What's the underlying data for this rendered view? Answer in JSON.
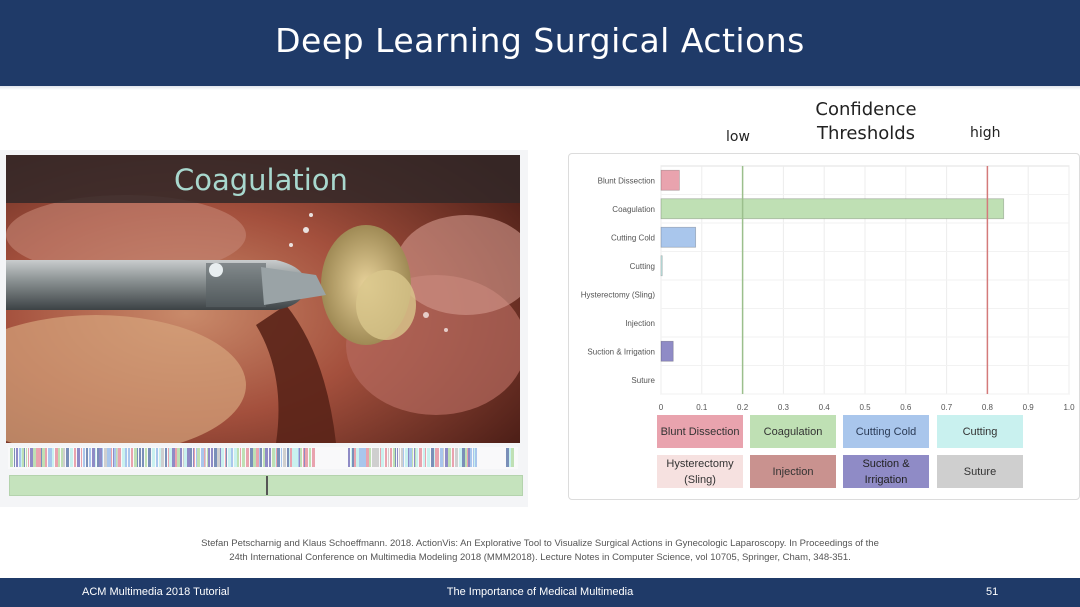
{
  "slide": {
    "title": "Deep Learning Surgical Actions",
    "confidence_title": "Confidence Thresholds",
    "low_label": "low",
    "high_label": "high"
  },
  "video": {
    "overlay_label": "Coagulation",
    "playhead_fraction": 0.5
  },
  "chart_data": {
    "type": "bar",
    "orientation": "horizontal",
    "categories": [
      "Blunt Dissection",
      "Coagulation",
      "Cutting Cold",
      "Cutting",
      "Hysterectomy (Sling)",
      "Injection",
      "Suction & Irrigation",
      "Suture"
    ],
    "values": [
      0.045,
      0.84,
      0.085,
      0.003,
      0,
      0,
      0.03,
      0
    ],
    "colors": [
      "#e9a3ae",
      "#bfe0b4",
      "#a9c6ec",
      "#c9f1ef",
      "#f6e1e0",
      "#c9928f",
      "#8f8bc6",
      "#cfcfcf"
    ],
    "xticks": [
      "0",
      "0.1",
      "0.2",
      "0.3",
      "0.4",
      "0.5",
      "0.6",
      "0.7",
      "0.8",
      "0.9",
      "1.0"
    ],
    "xlim": [
      0,
      1
    ],
    "thresholds": [
      {
        "value": 0.2,
        "color": "#9bbf8c"
      },
      {
        "value": 0.8,
        "color": "#d47a7a"
      }
    ],
    "grid": true
  },
  "legend": [
    {
      "label": "Blunt Dissection",
      "color": "#e9a3ae"
    },
    {
      "label": "Coagulation",
      "color": "#bfe0b4"
    },
    {
      "label": "Cutting Cold",
      "color": "#a9c6ec"
    },
    {
      "label": "Cutting",
      "color": "#c9f1ef"
    },
    {
      "label": "Hysterectomy (Sling)",
      "color": "#f6e1e0"
    },
    {
      "label": "Injection",
      "color": "#c9928f"
    },
    {
      "label": "Suction & Irrigation",
      "color": "#8f8bc6"
    },
    {
      "label": "Suture",
      "color": "#cfcfcf"
    }
  ],
  "citation": {
    "line1": "Stefan Petscharnig and Klaus Schoeffmann. 2018. ActionVis: An Explorative Tool to Visualize Surgical Actions in Gynecologic Laparoscopy. In Proceedings of the",
    "line2": "24th International Conference on Multimedia Modeling 2018 (MMM2018). Lecture Notes in Computer Science, vol 10705, Springer, Cham, 348-351."
  },
  "footer": {
    "left": "ACM Multimedia 2018 Tutorial",
    "center": "The Importance of Medical Multimedia",
    "page": "51"
  }
}
